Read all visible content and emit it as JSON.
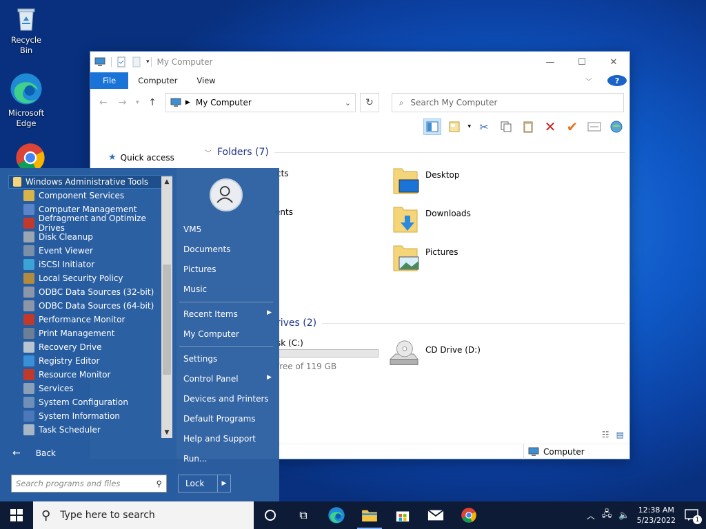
{
  "desktop": {
    "icons": [
      {
        "label": "Recycle Bin",
        "icon": "recycle-bin-icon"
      },
      {
        "label": "Microsoft Edge",
        "icon": "edge-icon"
      },
      {
        "label": "",
        "icon": "chrome-icon"
      }
    ]
  },
  "explorer": {
    "title": "My Computer",
    "tabs": [
      "File",
      "Computer",
      "View"
    ],
    "address": "My Computer",
    "search_placeholder": "Search My Computer",
    "nav": {
      "quick_access": "Quick access"
    },
    "folders_header": "Folders (7)",
    "folders": [
      {
        "label": "cts",
        "icon": "folder-icon"
      },
      {
        "label": "ents",
        "icon": "folder-icon"
      },
      {
        "label": "Desktop",
        "icon": "desktop-folder-icon"
      },
      {
        "label": "Downloads",
        "icon": "downloads-folder-icon"
      },
      {
        "label": "Pictures",
        "icon": "pictures-folder-icon"
      }
    ],
    "drives_header": "rives (2)",
    "drives": [
      {
        "label": "sk (C:)",
        "free": "free of 119 GB",
        "used_fraction": 0.0
      },
      {
        "label": "CD Drive (D:)"
      }
    ],
    "status_location": "Computer"
  },
  "start_menu": {
    "programs_header": "Windows Administrative Tools",
    "programs": [
      {
        "label": "Component Services",
        "color": "#d9b44a"
      },
      {
        "label": "Computer Management",
        "color": "#5a84c7"
      },
      {
        "label": "Defragment and Optimize Drives",
        "color": "#c0392b"
      },
      {
        "label": "Disk Cleanup",
        "color": "#9aa6b2"
      },
      {
        "label": "Event Viewer",
        "color": "#7a8fa8"
      },
      {
        "label": "iSCSI Initiator",
        "color": "#3ba3d6"
      },
      {
        "label": "Local Security Policy",
        "color": "#b28b3f"
      },
      {
        "label": "ODBC Data Sources (32-bit)",
        "color": "#8b97a8"
      },
      {
        "label": "ODBC Data Sources (64-bit)",
        "color": "#8b97a8"
      },
      {
        "label": "Performance Monitor",
        "color": "#c0392b"
      },
      {
        "label": "Print Management",
        "color": "#6d7f96"
      },
      {
        "label": "Recovery Drive",
        "color": "#b8c4cf"
      },
      {
        "label": "Registry Editor",
        "color": "#3a8fd6"
      },
      {
        "label": "Resource Monitor",
        "color": "#c0392b"
      },
      {
        "label": "Services",
        "color": "#8aa0b8"
      },
      {
        "label": "System Configuration",
        "color": "#6d8fb8"
      },
      {
        "label": "System Information",
        "color": "#4a78b8"
      },
      {
        "label": "Task Scheduler",
        "color": "#a7b7c6"
      }
    ],
    "back_label": "Back",
    "search_placeholder": "Search programs and files",
    "right_items": {
      "user": "VM5",
      "documents": "Documents",
      "pictures": "Pictures",
      "music": "Music",
      "recent": "Recent Items",
      "computer": "My Computer",
      "settings": "Settings",
      "control_panel": "Control Panel",
      "devices": "Devices and Printers",
      "default_programs": "Default Programs",
      "help": "Help and Support",
      "run": "Run..."
    },
    "lock_label": "Lock"
  },
  "taskbar": {
    "search_placeholder": "Type here to search",
    "time": "12:38 AM",
    "date": "5/23/2022",
    "notification_count": "1"
  }
}
